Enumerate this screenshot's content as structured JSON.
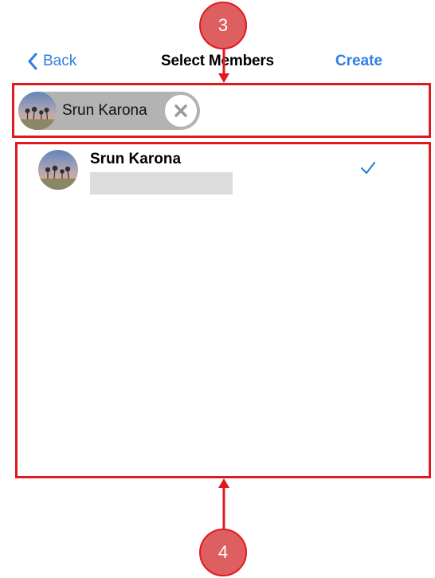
{
  "nav": {
    "back_label": "Back",
    "title": "Select Members",
    "create_label": "Create"
  },
  "selected_chip": {
    "name": "Srun Karona",
    "remove_icon": "close-circle-icon"
  },
  "members": [
    {
      "name": "Srun Karona",
      "subtitle": "",
      "selected": true,
      "check_icon": "checkmark-icon"
    }
  ],
  "annotations": [
    {
      "label": "3",
      "target": "selected-members-bar"
    },
    {
      "label": "4",
      "target": "member-list"
    }
  ],
  "colors": {
    "accent": "#2f7fe0",
    "annotation_red": "#e0191f",
    "annotation_fill": "#de5f5f",
    "chip_gray": "#b3b3b3",
    "placeholder_gray": "#dcdcdc"
  }
}
